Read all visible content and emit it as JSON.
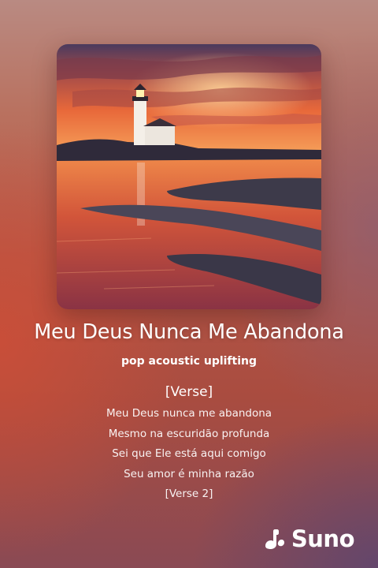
{
  "song": {
    "title": "Meu Deus Nunca Me Abandona",
    "style": "pop acoustic uplifting"
  },
  "lyrics": {
    "section_label": "[Verse]",
    "lines": [
      "Meu Deus nunca me abandona",
      "Mesmo na escuridão profunda",
      "Sei que Ele está aqui comigo",
      "Seu amor é minha razão",
      "[Verse 2]"
    ]
  },
  "brand": {
    "name": "Suno",
    "icon": "suno-logo-icon"
  },
  "colors": {
    "text": "#ffffff",
    "background_top": "#b98a82",
    "background_mid": "#b55747",
    "background_bottom": "#8a4a54"
  },
  "artwork": {
    "subject": "lighthouse-at-sunset"
  }
}
